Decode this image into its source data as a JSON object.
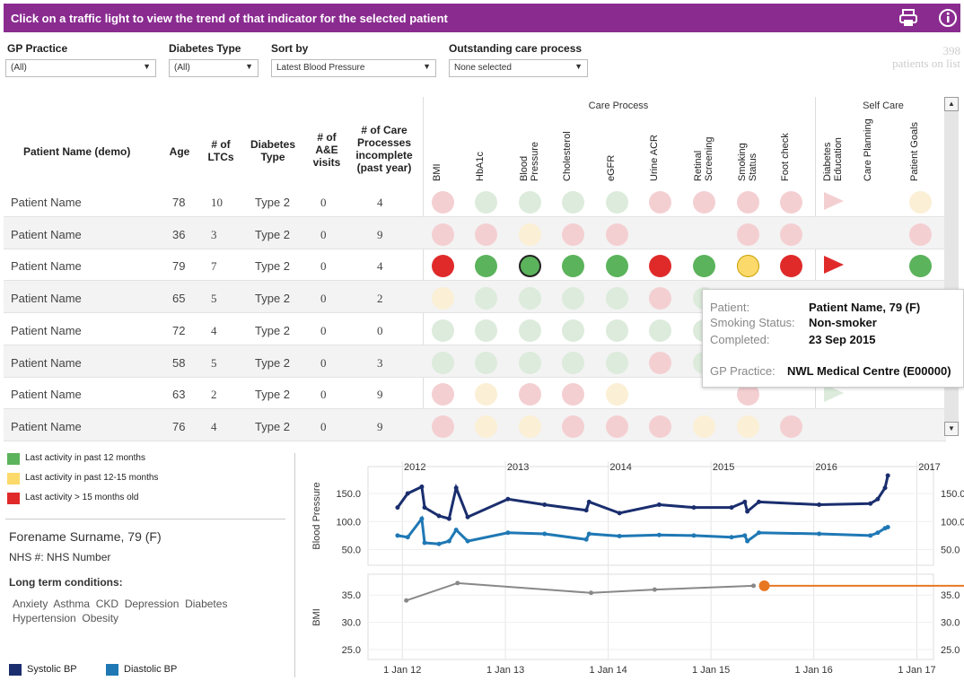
{
  "header": {
    "banner": "Click on a traffic light to view the trend of that indicator for the selected patient",
    "print_icon": "printer-icon",
    "info_icon": "info-icon"
  },
  "filters": {
    "gp_practice": {
      "label": "GP Practice",
      "value": "(All)"
    },
    "diabetes_type": {
      "label": "Diabetes Type",
      "value": "(All)"
    },
    "sort_by": {
      "label": "Sort by",
      "value": "Latest Blood Pressure"
    },
    "outstanding": {
      "label": "Outstanding care process",
      "value": "None selected"
    }
  },
  "patients_count": "398",
  "patients_label": "patients on list",
  "table": {
    "group_care": "Care Process",
    "group_self": "Self Care",
    "columns": {
      "name": "Patient Name (demo)",
      "age": "Age",
      "ltcs": "# of LTCs",
      "dtype": "Diabetes Type",
      "ae": "# of A&E visits",
      "incomplete": "# of Care Processes incomplete (past year)"
    },
    "indicators": [
      "BMI",
      "HbA1c",
      "Blood Pressure",
      "Cholesterol",
      "eGFR",
      "Urine ACR",
      "Retinal Screening",
      "Smoking Status",
      "Foot check",
      "Diabetes Education",
      "Care Planning",
      "Patient Goals"
    ],
    "rows": [
      {
        "name": "Patient Name",
        "age": "78",
        "ltcs": "10",
        "dtype": "Type 2",
        "ae": "0",
        "incomplete": "4",
        "lights": [
          "lr",
          "lg",
          "lg",
          "lg",
          "lg",
          "lr",
          "lr",
          "lr",
          "lr",
          "tlr",
          "",
          "ly"
        ]
      },
      {
        "name": "Patient Name",
        "age": "36",
        "ltcs": "3",
        "dtype": "Type 2",
        "ae": "0",
        "incomplete": "9",
        "lights": [
          "lr",
          "lr",
          "ly",
          "lr",
          "lr",
          "",
          "",
          "lr",
          "lr",
          "",
          "",
          "lr"
        ]
      },
      {
        "name": "Patient Name",
        "age": "79",
        "ltcs": "7",
        "dtype": "Type 2",
        "ae": "0",
        "incomplete": "4",
        "lights": [
          "R",
          "G",
          "Gsel",
          "G",
          "G",
          "R",
          "G",
          "Y",
          "R",
          "tR",
          "",
          "G"
        ]
      },
      {
        "name": "Patient Name",
        "age": "65",
        "ltcs": "5",
        "dtype": "Type 2",
        "ae": "0",
        "incomplete": "2",
        "lights": [
          "ly",
          "lg",
          "lg",
          "lg",
          "lg",
          "lr",
          "lg",
          "",
          "",
          "",
          "",
          ""
        ]
      },
      {
        "name": "Patient Name",
        "age": "72",
        "ltcs": "4",
        "dtype": "Type 2",
        "ae": "0",
        "incomplete": "0",
        "lights": [
          "lg",
          "lg",
          "lg",
          "lg",
          "lg",
          "lg",
          "lg",
          "",
          "",
          "",
          "",
          ""
        ]
      },
      {
        "name": "Patient Name",
        "age": "58",
        "ltcs": "5",
        "dtype": "Type 2",
        "ae": "0",
        "incomplete": "3",
        "lights": [
          "lg",
          "lg",
          "lg",
          "lg",
          "lg",
          "lr",
          "lg",
          "",
          "",
          "",
          "",
          ""
        ]
      },
      {
        "name": "Patient Name",
        "age": "63",
        "ltcs": "2",
        "dtype": "Type 2",
        "ae": "0",
        "incomplete": "9",
        "lights": [
          "lr",
          "ly",
          "lr",
          "lr",
          "ly",
          "",
          "",
          "lr",
          "",
          "tlg",
          "",
          ""
        ]
      },
      {
        "name": "Patient Name",
        "age": "76",
        "ltcs": "4",
        "dtype": "Type 2",
        "ae": "0",
        "incomplete": "9",
        "lights": [
          "lr",
          "ly",
          "ly",
          "lr",
          "lr",
          "lr",
          "ly",
          "ly",
          "lr",
          "",
          "",
          ""
        ]
      }
    ]
  },
  "tooltip": {
    "patient_label": "Patient:",
    "patient_value": "Patient Name, 79 (F)",
    "smoking_label": "Smoking Status:",
    "smoking_value": "Non-smoker",
    "completed_label": "Completed:",
    "completed_value": "23 Sep 2015",
    "gp_label": "GP Practice:",
    "gp_value": "NWL Medical Centre (E00000)"
  },
  "legend": {
    "items": [
      {
        "label": "Last activity in past 12 months",
        "color": "#5bb35b"
      },
      {
        "label": "Last activity in past 12-15 months",
        "color": "#fbd96a"
      },
      {
        "label": "Last activity > 15 months old",
        "color": "#e02a2a"
      }
    ]
  },
  "patient": {
    "name": "Forename Surname, 79 (F)",
    "nhs": "NHS #: NHS Number",
    "ltc_title": "Long term conditions:",
    "conditions_line1": "Anxiety  Asthma  CKD  Depression  Diabetes",
    "conditions_line2": "Hypertension  Obesity"
  },
  "colors": {
    "green": "#5bb35b",
    "red": "#e02a2a",
    "yellow": "#fbd96a",
    "lgreen": "#dcebdc",
    "lred": "#f4cfd2",
    "lyellow": "#fbefd5",
    "systolic": "#1a2e6e",
    "diastolic": "#1f78b4",
    "bmi": "#888888",
    "accent": "#e87722",
    "purple": "#8a2b90"
  },
  "chart_data": [
    {
      "type": "line",
      "title": "",
      "ylabel": "Blood Pressure",
      "x_year_labels": [
        "2012",
        "2013",
        "2014",
        "2015",
        "2016",
        "2017"
      ],
      "y_ticks": [
        "150.0",
        "100.0",
        "50.0"
      ],
      "ylim": [
        30,
        190
      ],
      "series": [
        {
          "name": "Systolic BP",
          "x": [
            "2011-12-15",
            "2012-01-20",
            "2012-03-10",
            "2012-03-20",
            "2012-05-10",
            "2012-06-15",
            "2012-07-10",
            "2012-08-20",
            "2013-01-10",
            "2013-05-20",
            "2013-10-15",
            "2013-10-25",
            "2014-02-10",
            "2014-07-01",
            "2014-11-01",
            "2015-03-15",
            "2015-05-01",
            "2015-05-10",
            "2015-06-20",
            "2016-01-20",
            "2016-07-20",
            "2016-08-15",
            "2016-09-10",
            "2016-09-20"
          ],
          "values": [
            125,
            150,
            162,
            125,
            110,
            105,
            160,
            108,
            140,
            130,
            120,
            135,
            115,
            130,
            125,
            125,
            135,
            118,
            135,
            130,
            132,
            140,
            160,
            182
          ]
        },
        {
          "name": "Diastolic BP",
          "x": [
            "2011-12-15",
            "2012-01-20",
            "2012-03-10",
            "2012-03-20",
            "2012-05-10",
            "2012-06-15",
            "2012-07-10",
            "2012-08-20",
            "2013-01-10",
            "2013-05-20",
            "2013-10-15",
            "2013-10-25",
            "2014-02-10",
            "2014-07-01",
            "2014-11-01",
            "2015-03-15",
            "2015-05-01",
            "2015-05-10",
            "2015-06-20",
            "2016-01-20",
            "2016-07-20",
            "2016-08-15",
            "2016-09-10",
            "2016-09-20"
          ],
          "values": [
            75,
            72,
            105,
            62,
            60,
            65,
            85,
            65,
            80,
            78,
            68,
            78,
            74,
            76,
            75,
            72,
            75,
            65,
            80,
            78,
            75,
            80,
            88,
            90
          ]
        }
      ]
    },
    {
      "type": "line",
      "title": "",
      "ylabel": "BMI",
      "x_tick_labels": [
        "1 Jan 12",
        "1 Jan 13",
        "1 Jan 14",
        "1 Jan 15",
        "1 Jan 16",
        "1 Jan 17"
      ],
      "y_ticks": [
        "35.0",
        "30.0",
        "25.0"
      ],
      "ylim": [
        24,
        38
      ],
      "series": [
        {
          "name": "BMI",
          "x": [
            "2012-01-15",
            "2012-07-15",
            "2013-11-01",
            "2014-06-15",
            "2015-06-01"
          ],
          "values": [
            34.0,
            37.2,
            35.4,
            36.0,
            36.7
          ]
        }
      ]
    }
  ],
  "chart_legend": {
    "systolic": "Systolic BP",
    "diastolic": "Diastolic BP"
  }
}
